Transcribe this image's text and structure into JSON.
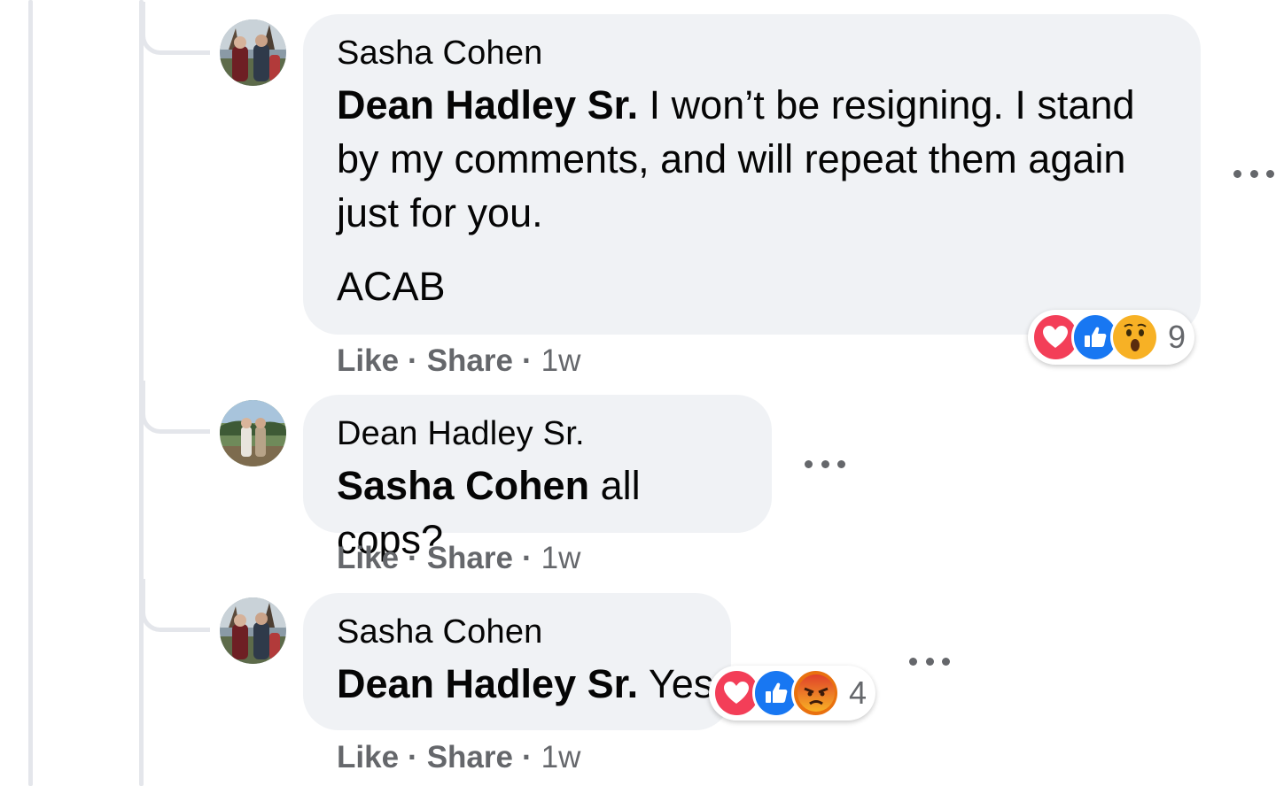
{
  "comments": [
    {
      "author": "Sasha Cohen",
      "mention": "Dean Hadley Sr.",
      "text": "I won’t be resigning. I stand by my comments, and will repeat them again just for you.",
      "text_line1": " I won’t be resigning. I stand",
      "text_line2": "by my comments, and will repeat them again",
      "text_line3": "just for you.",
      "paragraph2": "ACAB",
      "actions": {
        "like": "Like",
        "share": "Share",
        "time": "1w"
      },
      "reactions": {
        "icons": [
          "love-icon",
          "like-icon",
          "wow-icon"
        ],
        "count": "9"
      }
    },
    {
      "author": "Dean Hadley Sr.",
      "mention": "Sasha Cohen",
      "text": " all cops?",
      "actions": {
        "like": "Like",
        "share": "Share",
        "time": "1w"
      }
    },
    {
      "author": "Sasha Cohen",
      "mention": "Dean Hadley Sr.",
      "text": " Yes",
      "actions": {
        "like": "Like",
        "share": "Share",
        "time": "1w"
      },
      "reactions": {
        "icons": [
          "love-icon",
          "like-icon",
          "angry-icon"
        ],
        "count": "4"
      }
    }
  ],
  "separator": "·",
  "colors": {
    "bubble": "#f0f2f5",
    "secondary_text": "#65676b",
    "like_blue": "#1877f2",
    "love_red": "#f33e58",
    "wow_yellow": "#f7b125",
    "angry_orange": "#e9710f",
    "thread_line": "#e4e6eb"
  }
}
